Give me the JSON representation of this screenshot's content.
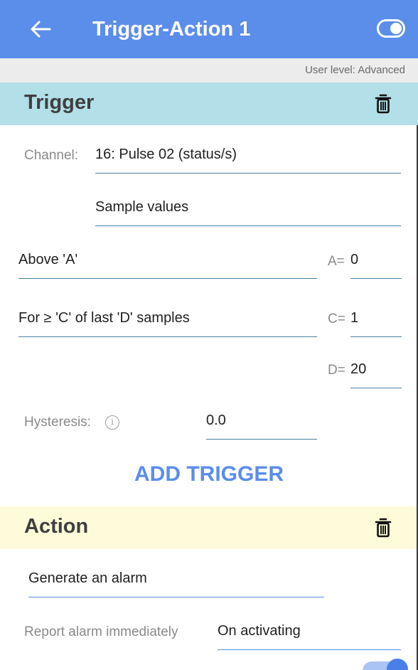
{
  "appbar": {
    "title": "Trigger-Action 1",
    "back_icon": "arrow-left-icon",
    "toggle_icon": "toggle-on-icon"
  },
  "user_level": "User level: Advanced",
  "trigger": {
    "heading": "Trigger",
    "channel_label": "Channel:",
    "channel_value": "16: Pulse 02 (status/s)",
    "sample_mode": "Sample values",
    "condition": "Above 'A'",
    "a_label": "A=",
    "a_value": "0",
    "count_rule": "For ≥ 'C' of last 'D' samples",
    "c_label": "C=",
    "c_value": "1",
    "d_label": "D=",
    "d_value": "20",
    "hysteresis_label": "Hysteresis:",
    "hysteresis_value": "0.0",
    "add_button": "ADD TRIGGER"
  },
  "action": {
    "heading": "Action",
    "action_value": "Generate an alarm",
    "report_label": "Report alarm immediately",
    "report_value": "On activating"
  },
  "colors": {
    "appbar": "#5b8dea",
    "trigger_header": "#b2dfe8",
    "action_header": "#fdfbd9",
    "accent": "#5b8dea"
  }
}
